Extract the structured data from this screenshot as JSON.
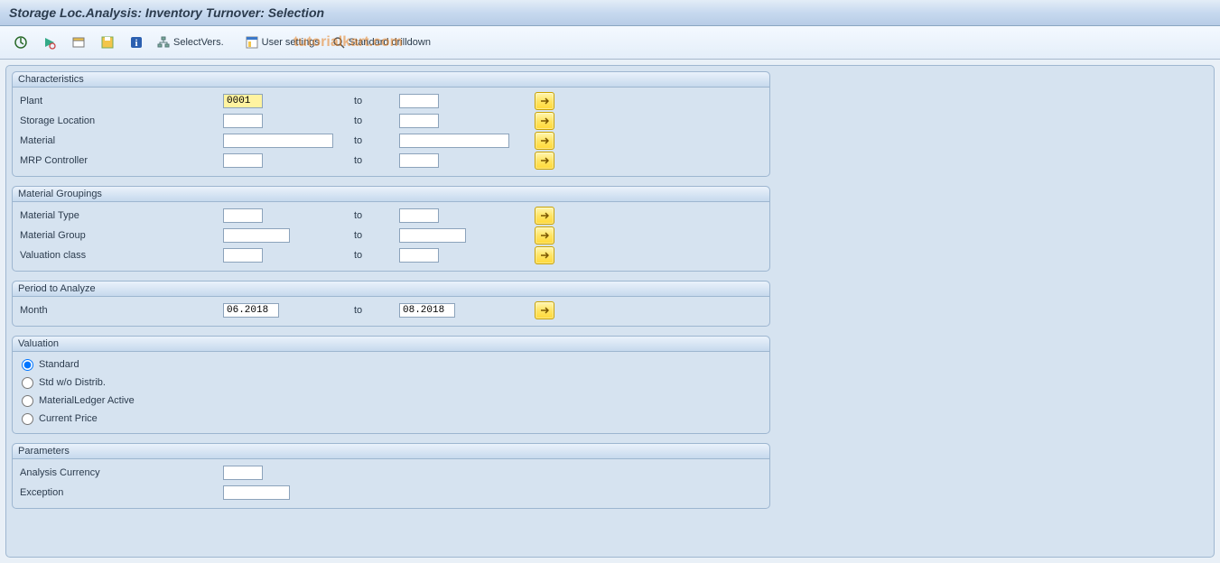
{
  "title": "Storage Loc.Analysis: Inventory Turnover: Selection",
  "toolbar": {
    "select_vers": "SelectVers.",
    "user_settings": "User settings",
    "standard_drilldown": "Standard drilldown"
  },
  "watermark": "tutorialkart.com",
  "groups": {
    "characteristics": {
      "title": "Characteristics",
      "rows": {
        "plant": {
          "label": "Plant",
          "from": "0001",
          "to_label": "to",
          "to": ""
        },
        "sloc": {
          "label": "Storage Location",
          "from": "",
          "to_label": "to",
          "to": ""
        },
        "material": {
          "label": "Material",
          "from": "",
          "to_label": "to",
          "to": ""
        },
        "mrp": {
          "label": "MRP Controller",
          "from": "",
          "to_label": "to",
          "to": ""
        }
      }
    },
    "mat_group": {
      "title": "Material Groupings",
      "rows": {
        "mtype": {
          "label": "Material Type",
          "from": "",
          "to_label": "to",
          "to": ""
        },
        "mgrp": {
          "label": "Material Group",
          "from": "",
          "to_label": "to",
          "to": ""
        },
        "vclass": {
          "label": "Valuation class",
          "from": "",
          "to_label": "to",
          "to": ""
        }
      }
    },
    "period": {
      "title": "Period to Analyze",
      "rows": {
        "month": {
          "label": "Month",
          "from": "06.2018",
          "to_label": "to",
          "to": "08.2018"
        }
      }
    },
    "valuation": {
      "title": "Valuation",
      "options": {
        "standard": "Standard",
        "std_wo": "Std w/o Distrib.",
        "ml_active": "MaterialLedger Active",
        "current": "Current Price"
      },
      "selected": "standard"
    },
    "parameters": {
      "title": "Parameters",
      "rows": {
        "currency": {
          "label": "Analysis Currency",
          "value": ""
        },
        "exception": {
          "label": "Exception",
          "value": ""
        }
      }
    }
  }
}
